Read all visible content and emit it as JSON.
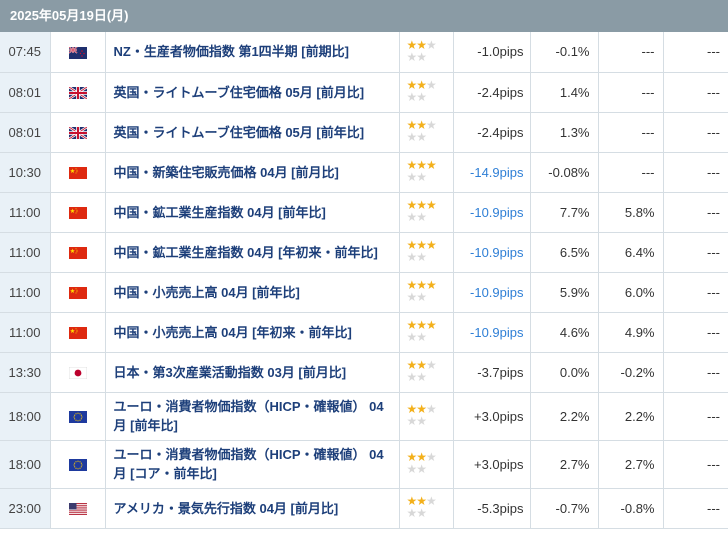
{
  "date_header": "2025年05月19日(月)",
  "rows": [
    {
      "time": "07:45",
      "flag": "nz",
      "flag_icon": "nz-flag-icon",
      "name": "NZ・生産者物価指数 第1四半期 [前期比]",
      "stars": 2,
      "pips": "-1.0pips",
      "pips_color": "#333333",
      "previous": "-0.1%",
      "forecast": "---",
      "result": "---"
    },
    {
      "time": "08:01",
      "flag": "gb",
      "flag_icon": "uk-flag-icon",
      "name": "英国・ライトムーブ住宅価格 05月 [前月比]",
      "stars": 2,
      "pips": "-2.4pips",
      "pips_color": "#333333",
      "previous": "1.4%",
      "forecast": "---",
      "result": "---"
    },
    {
      "time": "08:01",
      "flag": "gb",
      "flag_icon": "uk-flag-icon",
      "name": "英国・ライトムーブ住宅価格 05月 [前年比]",
      "stars": 2,
      "pips": "-2.4pips",
      "pips_color": "#333333",
      "previous": "1.3%",
      "forecast": "---",
      "result": "---"
    },
    {
      "time": "10:30",
      "flag": "cn",
      "flag_icon": "china-flag-icon",
      "name": "中国・新築住宅販売価格 04月 [前月比]",
      "stars": 3,
      "pips": "-14.9pips",
      "pips_color": "#2f7fd6",
      "previous": "-0.08%",
      "forecast": "---",
      "result": "---"
    },
    {
      "time": "11:00",
      "flag": "cn",
      "flag_icon": "china-flag-icon",
      "name": "中国・鉱工業生産指数 04月 [前年比]",
      "stars": 3,
      "pips": "-10.9pips",
      "pips_color": "#2f7fd6",
      "previous": "7.7%",
      "forecast": "5.8%",
      "result": "---"
    },
    {
      "time": "11:00",
      "flag": "cn",
      "flag_icon": "china-flag-icon",
      "name": "中国・鉱工業生産指数 04月 [年初来・前年比]",
      "stars": 3,
      "pips": "-10.9pips",
      "pips_color": "#2f7fd6",
      "previous": "6.5%",
      "forecast": "6.4%",
      "result": "---"
    },
    {
      "time": "11:00",
      "flag": "cn",
      "flag_icon": "china-flag-icon",
      "name": "中国・小売売上高 04月 [前年比]",
      "stars": 3,
      "pips": "-10.9pips",
      "pips_color": "#2f7fd6",
      "previous": "5.9%",
      "forecast": "6.0%",
      "result": "---"
    },
    {
      "time": "11:00",
      "flag": "cn",
      "flag_icon": "china-flag-icon",
      "name": "中国・小売売上高 04月 [年初来・前年比]",
      "stars": 3,
      "pips": "-10.9pips",
      "pips_color": "#2f7fd6",
      "previous": "4.6%",
      "forecast": "4.9%",
      "result": "---"
    },
    {
      "time": "13:30",
      "flag": "jp",
      "flag_icon": "japan-flag-icon",
      "name": "日本・第3次産業活動指数 03月 [前月比]",
      "stars": 2,
      "pips": "-3.7pips",
      "pips_color": "#333333",
      "previous": "0.0%",
      "forecast": "-0.2%",
      "result": "---"
    },
    {
      "time": "18:00",
      "flag": "eu",
      "flag_icon": "eu-flag-icon",
      "name": "ユーロ・消費者物価指数（HICP・確報値） 04月 [前年比]",
      "stars": 2,
      "pips": "+3.0pips",
      "pips_color": "#333333",
      "previous": "2.2%",
      "forecast": "2.2%",
      "result": "---",
      "tall": true
    },
    {
      "time": "18:00",
      "flag": "eu",
      "flag_icon": "eu-flag-icon",
      "name": "ユーロ・消費者物価指数（HICP・確報値） 04月 [コア・前年比]",
      "stars": 2,
      "pips": "+3.0pips",
      "pips_color": "#333333",
      "previous": "2.7%",
      "forecast": "2.7%",
      "result": "---",
      "tall": true
    },
    {
      "time": "23:00",
      "flag": "us",
      "flag_icon": "us-flag-icon",
      "name": "アメリカ・景気先行指数 04月 [前月比]",
      "stars": 2,
      "pips": "-5.3pips",
      "pips_color": "#333333",
      "previous": "-0.7%",
      "forecast": "-0.8%",
      "result": "---"
    }
  ],
  "colors": {
    "header_bg": "#8a9ba5",
    "time_bg": "#e9f1f7",
    "link": "#1d3f7a",
    "star_on": "#f3b01b",
    "star_off": "#d8d8d8",
    "pips_blue": "#2f7fd6"
  }
}
